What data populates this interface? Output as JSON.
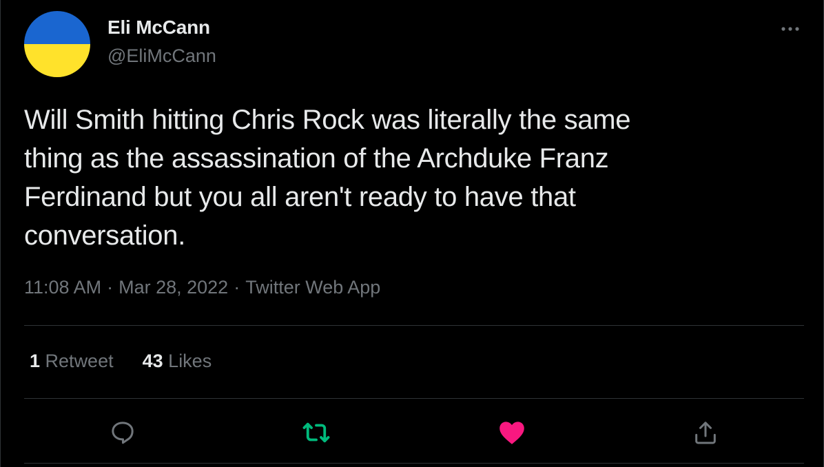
{
  "author": {
    "display_name": "Eli McCann",
    "handle": "@EliMcCann",
    "avatar": {
      "icon": "ukraine-flag-avatar",
      "flag_top_color": "#1a66d0",
      "flag_bottom_color": "#ffe22b"
    }
  },
  "tweet": {
    "text": "Will Smith hitting Chris Rock was literally the same\nthing as the assassination of the Archduke Franz\nFerdinand but you all aren't ready to have that\nconversation.",
    "time": "11:08 AM",
    "separator": "·",
    "date": "Mar 28, 2022",
    "source": "Twitter Web App"
  },
  "stats": {
    "retweets_count": "1",
    "retweets_label": "Retweet",
    "likes_count": "43",
    "likes_label": "Likes"
  },
  "actions": {
    "reply_icon": "reply-icon",
    "retweet_icon": "retweet-icon",
    "like_icon": "heart-icon",
    "share_icon": "share-icon",
    "retweet_color": "#00ba7c",
    "like_color": "#f91880",
    "neutral_color": "#71767b"
  },
  "theme": {
    "background": "#000000",
    "text": "#e7e9ea",
    "muted": "#71767b",
    "border": "#2f3336"
  }
}
